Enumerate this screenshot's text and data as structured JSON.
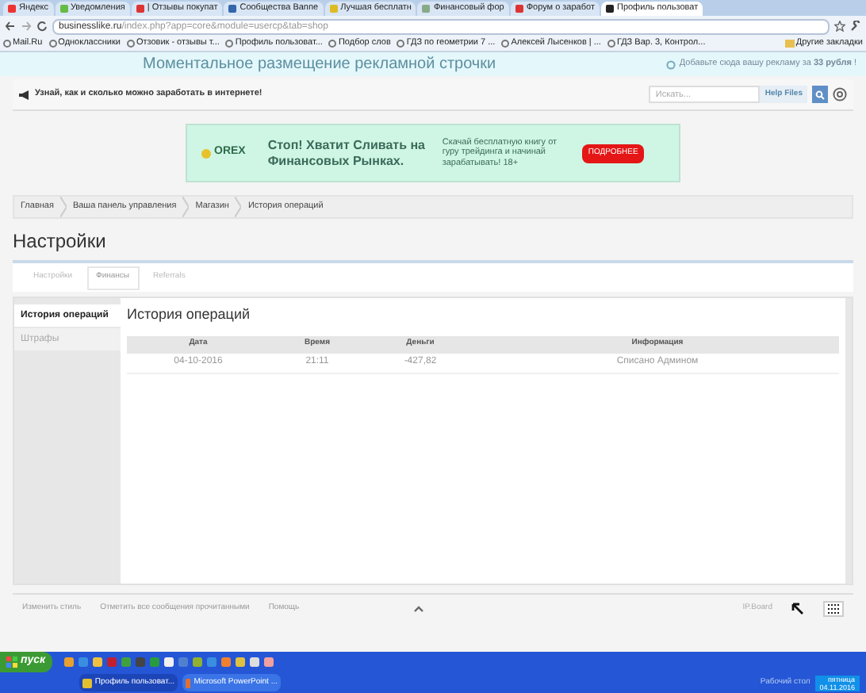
{
  "browser": {
    "tabs": [
      {
        "label": "Яндекс",
        "selected": false
      },
      {
        "label": "Уведомления",
        "selected": false
      },
      {
        "label": "| Отзывы покупат",
        "selected": false
      },
      {
        "label": "Сообщества Banne",
        "selected": false
      },
      {
        "label": "Лучшая бесплатн",
        "selected": false
      },
      {
        "label": "Финансовый фор",
        "selected": false
      },
      {
        "label": "Форум о заработ",
        "selected": false
      },
      {
        "label": "Профиль пользоват",
        "selected": true
      }
    ],
    "address_host": "businesslike.ru",
    "address_path": "/index.php?app=core&module=usercp&tab=shop",
    "bookmarks": [
      "Mail.Ru",
      "Одноклассники",
      "Отзовик - отзывы т...",
      "Профиль пользоват...",
      "Подбор слов",
      "ГДЗ по геометрии 7 ...",
      "Алексей Лысенков | ...",
      "ГДЗ Вар. 3, Контрол..."
    ],
    "other_bookmarks": "Другие закладки"
  },
  "promo_banner": {
    "title": "Моментальное размещение рекламной строчки",
    "offer": "Добавьте сюда вашу рекламу за **33 рубля** !"
  },
  "header": {
    "tagline": "Узнай, как и сколько можно заработать в интернете!",
    "search_placeholder": "Искать...",
    "help_button": "Help Files"
  },
  "ad": {
    "logo": "OREX",
    "headline": "Стоп! Хватит Сливать на Финансовых Рынках.",
    "text": "Скачай бесплатную книгу от гуру трейдинга и начинай зарабатывать! 18+",
    "button": "ПОДРОБНЕЕ"
  },
  "breadcrumbs": [
    "Главная",
    "Ваша панель управления",
    "Магазин",
    "История операций"
  ],
  "page_title": "Настройки",
  "tabs": [
    {
      "label": "Настройки",
      "selected": false
    },
    {
      "label": "Финансы",
      "selected": true
    },
    {
      "label": "Referrals",
      "selected": false
    }
  ],
  "sidebar": [
    {
      "label": "История операций",
      "selected": true
    },
    {
      "label": "Штрафы",
      "selected": false
    }
  ],
  "panel": {
    "title": "История операций",
    "table": {
      "columns": [
        "Дата",
        "Время",
        "Деньги",
        "Информация"
      ],
      "rows": [
        [
          "04-10-2016",
          "21:11",
          "-427,82",
          "Списано Админом"
        ]
      ]
    }
  },
  "footer": {
    "links": [
      "Изменить стиль",
      "Отметить все сообщения прочитанными",
      "Помощь"
    ],
    "brand": "IP.Board"
  },
  "taskbar": {
    "start": "пуск",
    "tasks": [
      {
        "label": "Профиль пользоват...",
        "selected": true
      },
      {
        "label": "Microsoft PowerPoint ...",
        "selected": false
      }
    ],
    "desktop": "Рабочий стол",
    "day": "пятница",
    "date": "04.11.2016"
  }
}
